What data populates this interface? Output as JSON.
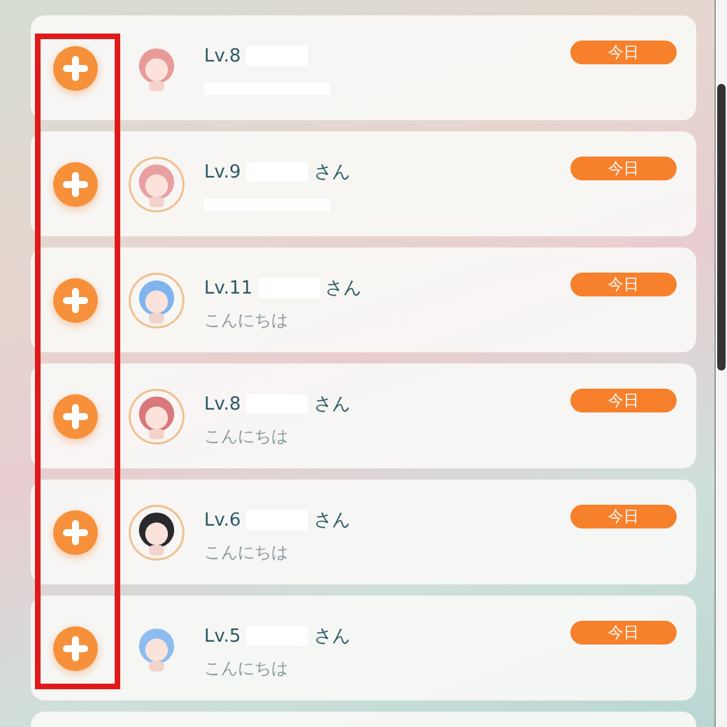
{
  "annotation": {
    "kind": "box"
  },
  "rows": [
    {
      "level": "Lv.8",
      "name_hidden": true,
      "badge": "今日",
      "message_hidden": true,
      "avatar": {
        "color": "#e89a98",
        "ring": false
      }
    },
    {
      "level": "Lv.9",
      "name_hidden": true,
      "suffix": "さん",
      "badge": "今日",
      "message_hidden": true,
      "avatar": {
        "color": "#e8a0a0",
        "ring": true
      }
    },
    {
      "level": "Lv.11",
      "name_hidden": true,
      "suffix": "さん",
      "badge": "今日",
      "message": "こんにちは",
      "avatar": {
        "color": "#7fb4ee",
        "ring": true
      }
    },
    {
      "level": "Lv.8",
      "name_hidden": true,
      "suffix": "さん",
      "badge": "今日",
      "message": "こんにちは",
      "avatar": {
        "color": "#d9787a",
        "ring": true
      }
    },
    {
      "level": "Lv.6",
      "name_hidden": true,
      "suffix": "さん",
      "badge": "今日",
      "message": "こんにちは",
      "avatar": {
        "color": "#2a2a2e",
        "ring": true
      }
    },
    {
      "level": "Lv.5",
      "name_hidden": true,
      "suffix": "さん",
      "badge": "今日",
      "message": "こんにちは",
      "avatar": {
        "color": "#8cbcf0",
        "ring": false
      }
    }
  ]
}
